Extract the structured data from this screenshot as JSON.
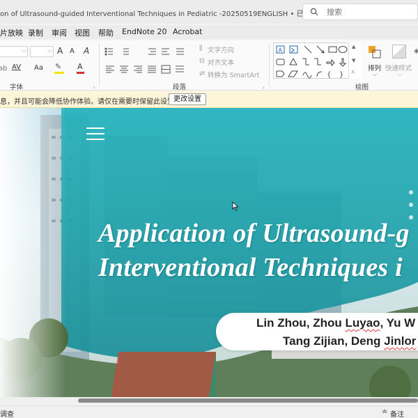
{
  "window": {
    "title": "on of Ultrasound-guided Interventional Techniques in Pediatric  -20250519ENGLISH • 已保存",
    "search_placeholder": "搜索"
  },
  "menu": {
    "tabs": [
      "片放映",
      "录制",
      "审阅",
      "视图",
      "帮助",
      "EndNote 20",
      "Acrobat"
    ]
  },
  "ribbon": {
    "font_group_label": "字体",
    "paragraph_group_label": "段落",
    "drawing_group_label": "绘图",
    "text_direction": "文字方向",
    "align_text": "对齐文本",
    "convert_smartart": "转换为 SmartArt",
    "arrange_label": "排列",
    "quick_styles_label": "快速样式",
    "font_size_up": "A",
    "font_size_down": "A",
    "clear_format": "A",
    "char_spacing": "AV",
    "change_case": "Aa",
    "font_color": "A"
  },
  "infobar": {
    "message": "息，并且可能会降低协作体验。请仅在需要时保留此设置。",
    "button": "更改设置"
  },
  "slide": {
    "title_line1": "Application of Ultrasound-g",
    "title_line2": "Interventional Techniques i",
    "authors_line1_a": "Lin Zhou, Zhou ",
    "authors_line1_b": "Luyao",
    "authors_line1_c": ", Yu W",
    "authors_line2_a": "Tang Zijian, Deng ",
    "authors_line2_b": "Jinlor"
  },
  "status": {
    "left": "调查",
    "notes": "备注"
  },
  "colors": {
    "slide_teal": "#1aa6b0",
    "infobar_bg": "#fdf5d8"
  }
}
